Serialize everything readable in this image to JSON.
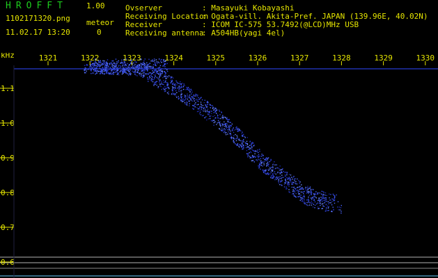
{
  "header": {
    "app_title": "HROFFT",
    "version": "1.00",
    "filename": "1102171320.png",
    "meteor_label": "meteor",
    "datetime": "11.02.17 13:20",
    "meteor_count": "0",
    "info": [
      {
        "label": "Ovserver",
        "value": ": Masayuki Kobayashi"
      },
      {
        "label": "Receiving Location",
        "value": ": Ogata-vill. Akita-Pref. JAPAN (139.96E, 40.02N)"
      },
      {
        "label": "Receiver",
        "value": ": ICOM IC-575 53.7492(@LCD)MHz USB"
      },
      {
        "label": "Receiving antenna",
        "value": ": A504HB(yagi 4el)"
      }
    ]
  },
  "colors": {
    "background": "#000000",
    "label": "#e6e600",
    "title": "#1ecc1e",
    "signal": "#3a5cff",
    "grid": "#c8c8c8"
  },
  "spectrogram": {
    "y_unit": "kHz",
    "time_ticks": [
      "1321",
      "1322",
      "1323",
      "1324",
      "1325",
      "1326",
      "1327",
      "1328",
      "1329",
      "1330"
    ],
    "freq_ticks": [
      "1.1",
      "1.0",
      "0.9",
      "0.8",
      "0.7",
      "0.6"
    ]
  }
}
